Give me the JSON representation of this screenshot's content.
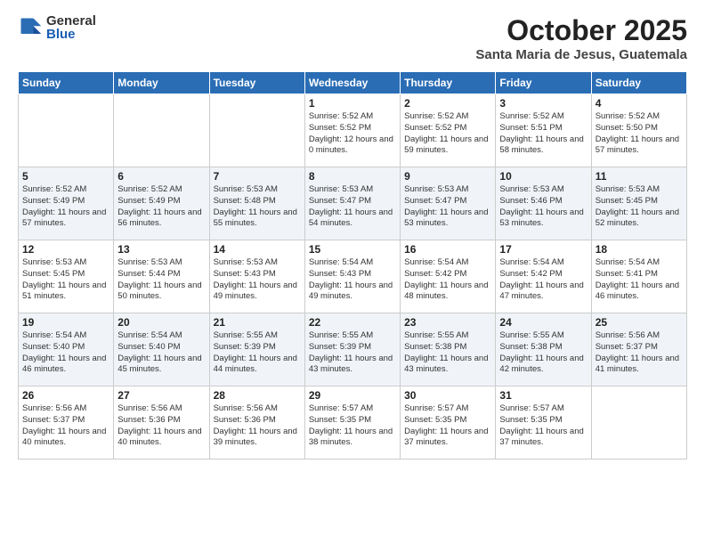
{
  "logo": {
    "general": "General",
    "blue": "Blue"
  },
  "title": {
    "month": "October 2025",
    "location": "Santa Maria de Jesus, Guatemala"
  },
  "weekdays": [
    "Sunday",
    "Monday",
    "Tuesday",
    "Wednesday",
    "Thursday",
    "Friday",
    "Saturday"
  ],
  "weeks": [
    [
      {
        "day": "",
        "info": ""
      },
      {
        "day": "",
        "info": ""
      },
      {
        "day": "",
        "info": ""
      },
      {
        "day": "1",
        "info": "Sunrise: 5:52 AM\nSunset: 5:52 PM\nDaylight: 12 hours\nand 0 minutes."
      },
      {
        "day": "2",
        "info": "Sunrise: 5:52 AM\nSunset: 5:52 PM\nDaylight: 11 hours\nand 59 minutes."
      },
      {
        "day": "3",
        "info": "Sunrise: 5:52 AM\nSunset: 5:51 PM\nDaylight: 11 hours\nand 58 minutes."
      },
      {
        "day": "4",
        "info": "Sunrise: 5:52 AM\nSunset: 5:50 PM\nDaylight: 11 hours\nand 57 minutes."
      }
    ],
    [
      {
        "day": "5",
        "info": "Sunrise: 5:52 AM\nSunset: 5:49 PM\nDaylight: 11 hours\nand 57 minutes."
      },
      {
        "day": "6",
        "info": "Sunrise: 5:52 AM\nSunset: 5:49 PM\nDaylight: 11 hours\nand 56 minutes."
      },
      {
        "day": "7",
        "info": "Sunrise: 5:53 AM\nSunset: 5:48 PM\nDaylight: 11 hours\nand 55 minutes."
      },
      {
        "day": "8",
        "info": "Sunrise: 5:53 AM\nSunset: 5:47 PM\nDaylight: 11 hours\nand 54 minutes."
      },
      {
        "day": "9",
        "info": "Sunrise: 5:53 AM\nSunset: 5:47 PM\nDaylight: 11 hours\nand 53 minutes."
      },
      {
        "day": "10",
        "info": "Sunrise: 5:53 AM\nSunset: 5:46 PM\nDaylight: 11 hours\nand 53 minutes."
      },
      {
        "day": "11",
        "info": "Sunrise: 5:53 AM\nSunset: 5:45 PM\nDaylight: 11 hours\nand 52 minutes."
      }
    ],
    [
      {
        "day": "12",
        "info": "Sunrise: 5:53 AM\nSunset: 5:45 PM\nDaylight: 11 hours\nand 51 minutes."
      },
      {
        "day": "13",
        "info": "Sunrise: 5:53 AM\nSunset: 5:44 PM\nDaylight: 11 hours\nand 50 minutes."
      },
      {
        "day": "14",
        "info": "Sunrise: 5:53 AM\nSunset: 5:43 PM\nDaylight: 11 hours\nand 49 minutes."
      },
      {
        "day": "15",
        "info": "Sunrise: 5:54 AM\nSunset: 5:43 PM\nDaylight: 11 hours\nand 49 minutes."
      },
      {
        "day": "16",
        "info": "Sunrise: 5:54 AM\nSunset: 5:42 PM\nDaylight: 11 hours\nand 48 minutes."
      },
      {
        "day": "17",
        "info": "Sunrise: 5:54 AM\nSunset: 5:42 PM\nDaylight: 11 hours\nand 47 minutes."
      },
      {
        "day": "18",
        "info": "Sunrise: 5:54 AM\nSunset: 5:41 PM\nDaylight: 11 hours\nand 46 minutes."
      }
    ],
    [
      {
        "day": "19",
        "info": "Sunrise: 5:54 AM\nSunset: 5:40 PM\nDaylight: 11 hours\nand 46 minutes."
      },
      {
        "day": "20",
        "info": "Sunrise: 5:54 AM\nSunset: 5:40 PM\nDaylight: 11 hours\nand 45 minutes."
      },
      {
        "day": "21",
        "info": "Sunrise: 5:55 AM\nSunset: 5:39 PM\nDaylight: 11 hours\nand 44 minutes."
      },
      {
        "day": "22",
        "info": "Sunrise: 5:55 AM\nSunset: 5:39 PM\nDaylight: 11 hours\nand 43 minutes."
      },
      {
        "day": "23",
        "info": "Sunrise: 5:55 AM\nSunset: 5:38 PM\nDaylight: 11 hours\nand 43 minutes."
      },
      {
        "day": "24",
        "info": "Sunrise: 5:55 AM\nSunset: 5:38 PM\nDaylight: 11 hours\nand 42 minutes."
      },
      {
        "day": "25",
        "info": "Sunrise: 5:56 AM\nSunset: 5:37 PM\nDaylight: 11 hours\nand 41 minutes."
      }
    ],
    [
      {
        "day": "26",
        "info": "Sunrise: 5:56 AM\nSunset: 5:37 PM\nDaylight: 11 hours\nand 40 minutes."
      },
      {
        "day": "27",
        "info": "Sunrise: 5:56 AM\nSunset: 5:36 PM\nDaylight: 11 hours\nand 40 minutes."
      },
      {
        "day": "28",
        "info": "Sunrise: 5:56 AM\nSunset: 5:36 PM\nDaylight: 11 hours\nand 39 minutes."
      },
      {
        "day": "29",
        "info": "Sunrise: 5:57 AM\nSunset: 5:35 PM\nDaylight: 11 hours\nand 38 minutes."
      },
      {
        "day": "30",
        "info": "Sunrise: 5:57 AM\nSunset: 5:35 PM\nDaylight: 11 hours\nand 37 minutes."
      },
      {
        "day": "31",
        "info": "Sunrise: 5:57 AM\nSunset: 5:35 PM\nDaylight: 11 hours\nand 37 minutes."
      },
      {
        "day": "",
        "info": ""
      }
    ]
  ]
}
